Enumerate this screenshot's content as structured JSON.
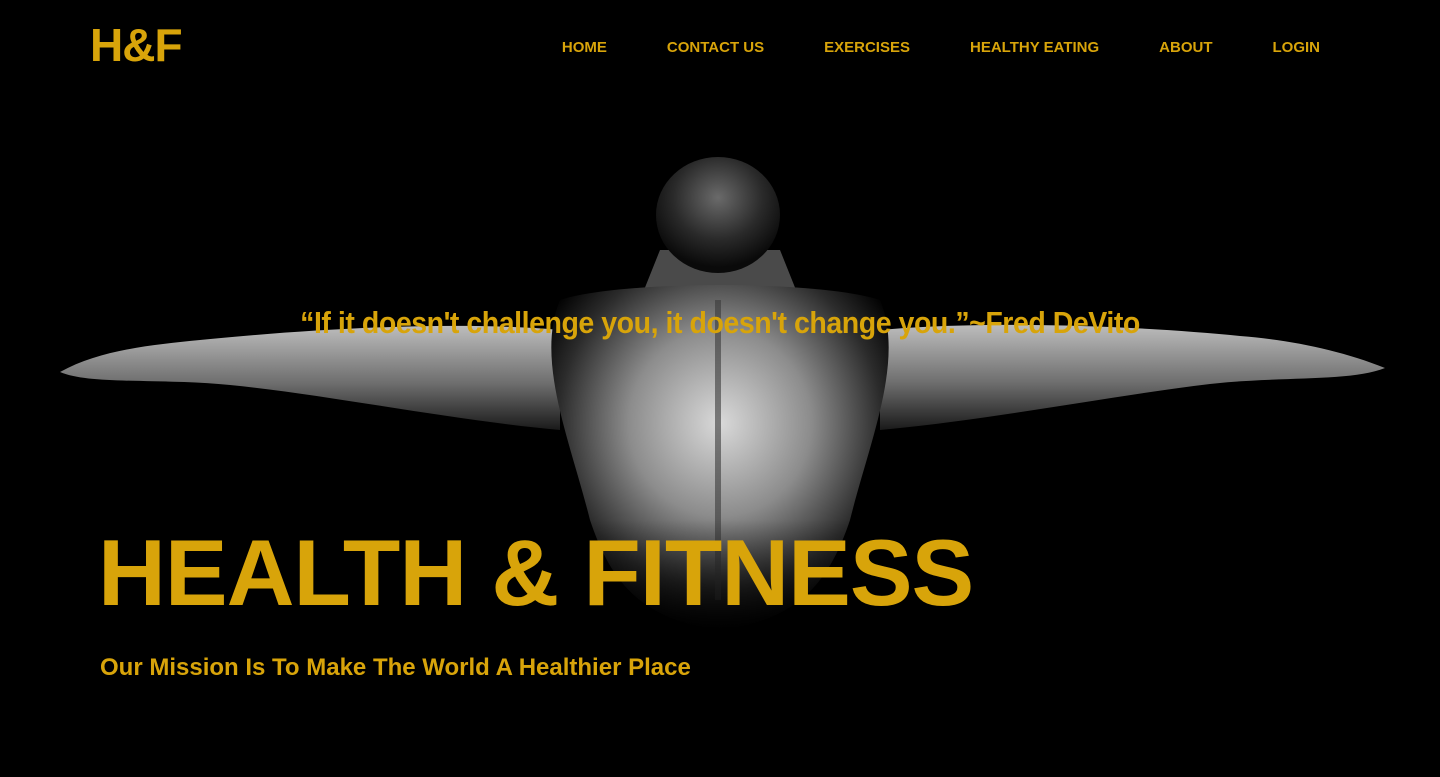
{
  "brand": {
    "logo_text": "H&F",
    "accent_color": "#D8A40A",
    "background_color": "#000000"
  },
  "nav": {
    "items": [
      {
        "label": "HOME"
      },
      {
        "label": "CONTACT US"
      },
      {
        "label": "EXERCISES"
      },
      {
        "label": "HEALTHY EATING"
      },
      {
        "label": "ABOUT"
      },
      {
        "label": "LOGIN"
      }
    ]
  },
  "hero": {
    "quote": "“If it doesn't challenge you,  it doesn't change you.”~Fred DeVito",
    "title": "HEALTH & FITNESS",
    "subtitle": "Our Mission Is To Make The World A Healthier Place"
  }
}
